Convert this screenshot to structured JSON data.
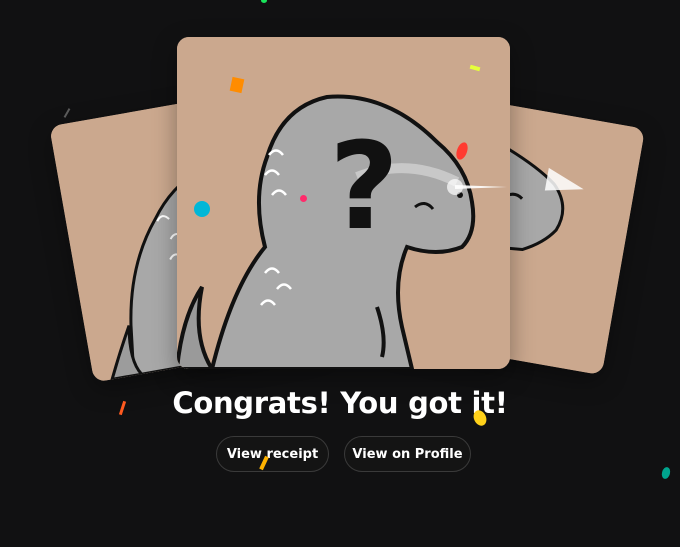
{
  "reveal": {
    "headline": "Congrats! You got it!",
    "mystery_mark": "?"
  },
  "actions": {
    "view_receipt_label": "View receipt",
    "view_profile_label": "View on Profile"
  },
  "colors": {
    "background": "#111112",
    "card": "#cba88e",
    "dino": "#a8a8a8",
    "outline": "#111111",
    "confetti": [
      "#ff8c00",
      "#e6ff3a",
      "#ff3b30",
      "#00b7d7",
      "#ff2b6b",
      "#ffd11a",
      "#00a58e",
      "#19e35a"
    ]
  },
  "icons": [
    "question-mark-icon",
    "sparkle-icon"
  ]
}
